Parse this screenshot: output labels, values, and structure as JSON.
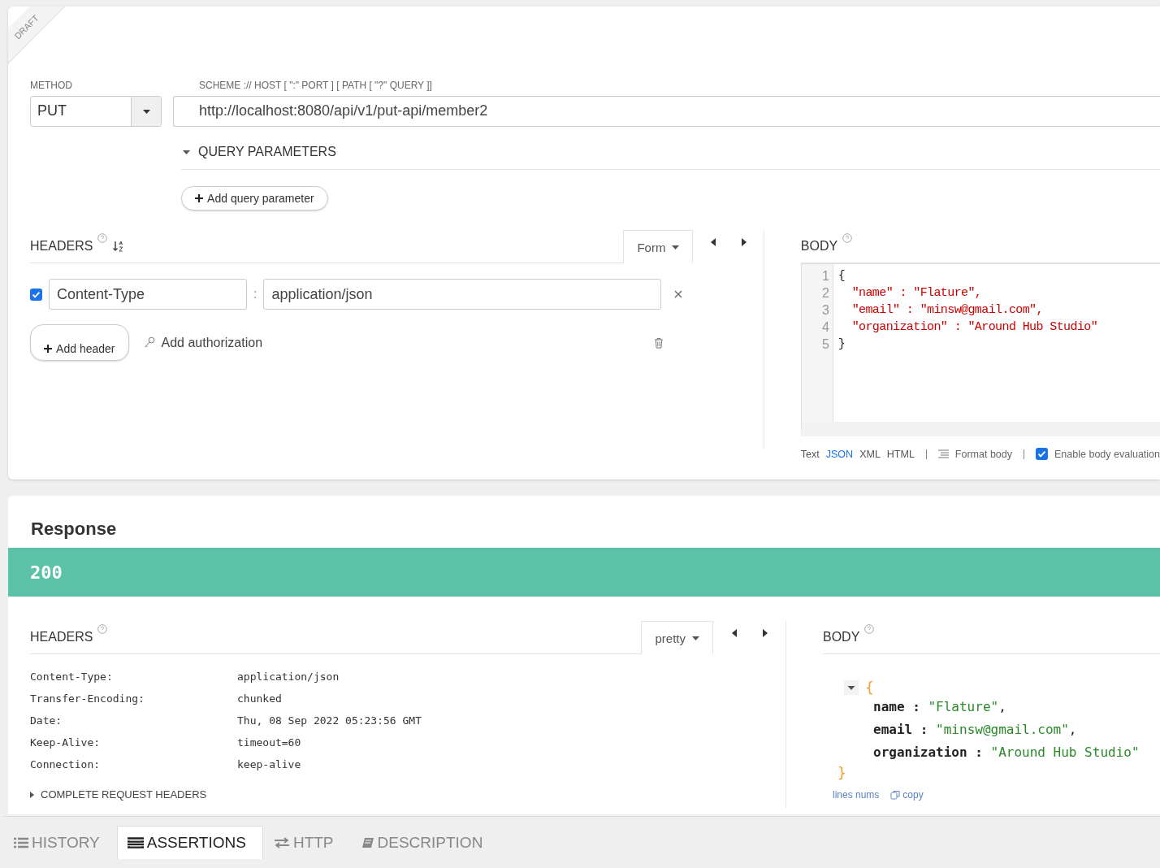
{
  "draft_label": "DRAFT",
  "request": {
    "method": {
      "label": "METHOD",
      "value": "PUT"
    },
    "url": {
      "label": "SCHEME :// HOST [ \":\" PORT ] [ PATH [ \"?\" QUERY ]]",
      "value": "http://localhost:8080/api/v1/put-api/member2"
    },
    "query_parameters": {
      "title": "QUERY PARAMETERS",
      "expanded": true,
      "add_button": "Add query parameter"
    },
    "headers": {
      "title": "HEADERS",
      "mode": "Form",
      "rows": [
        {
          "enabled": true,
          "name": "Content-Type",
          "separator": ":",
          "value": "application/json"
        }
      ],
      "add_button": "Add header",
      "auth_link": "Add authorization"
    },
    "body": {
      "title": "BODY",
      "lines": [
        {
          "number": "1",
          "kind": "punct",
          "text": "{"
        },
        {
          "number": "2",
          "kind": "string",
          "text": "  \"name\" : \"Flature\","
        },
        {
          "number": "3",
          "kind": "string",
          "text": "  \"email\" : \"minsw@gmail.com\","
        },
        {
          "number": "4",
          "kind": "string",
          "text": "  \"organization\" : \"Around Hub Studio\""
        },
        {
          "number": "5",
          "kind": "punct",
          "text": "}"
        }
      ],
      "formats": [
        {
          "label": "Text",
          "selected": false
        },
        {
          "label": "JSON",
          "selected": true
        },
        {
          "label": "XML",
          "selected": false
        },
        {
          "label": "HTML",
          "selected": false
        }
      ],
      "format_button": "Format body",
      "evaluation": {
        "label": "Enable body evaluation",
        "checked": true
      }
    }
  },
  "response": {
    "title": "Response",
    "status": "200",
    "headers": {
      "title": "HEADERS",
      "mode": "pretty",
      "rows": [
        {
          "name": "Content-Type:",
          "value": "application/json"
        },
        {
          "name": "Transfer-Encoding:",
          "value": "chunked"
        },
        {
          "name": "Date:",
          "value": "Thu, 08 Sep 2022 05:23:56 GMT"
        },
        {
          "name": "Keep-Alive:",
          "value": "timeout=60"
        },
        {
          "name": "Connection:",
          "value": "keep-alive"
        }
      ],
      "complete_toggle": "COMPLETE REQUEST HEADERS"
    },
    "body": {
      "title": "BODY",
      "expanded": true,
      "open": "{",
      "close": "}",
      "fields": [
        {
          "key": "name",
          "sep": ":",
          "value": "\"Flature\"",
          "punct": ","
        },
        {
          "key": "email",
          "sep": ":",
          "value": "\"minsw@gmail.com\"",
          "punct": ","
        },
        {
          "key": "organization",
          "sep": ":",
          "value": "\"Around Hub Studio\""
        }
      ],
      "links": [
        "lines nums",
        "copy"
      ]
    }
  },
  "bottom_tabs": [
    {
      "kind": "history",
      "label": "HISTORY",
      "selected": false
    },
    {
      "kind": "assertions",
      "label": "ASSERTIONS",
      "selected": true
    },
    {
      "kind": "http",
      "label": "HTTP",
      "selected": false
    },
    {
      "kind": "description",
      "label": "DESCRIPTION",
      "selected": false
    }
  ]
}
